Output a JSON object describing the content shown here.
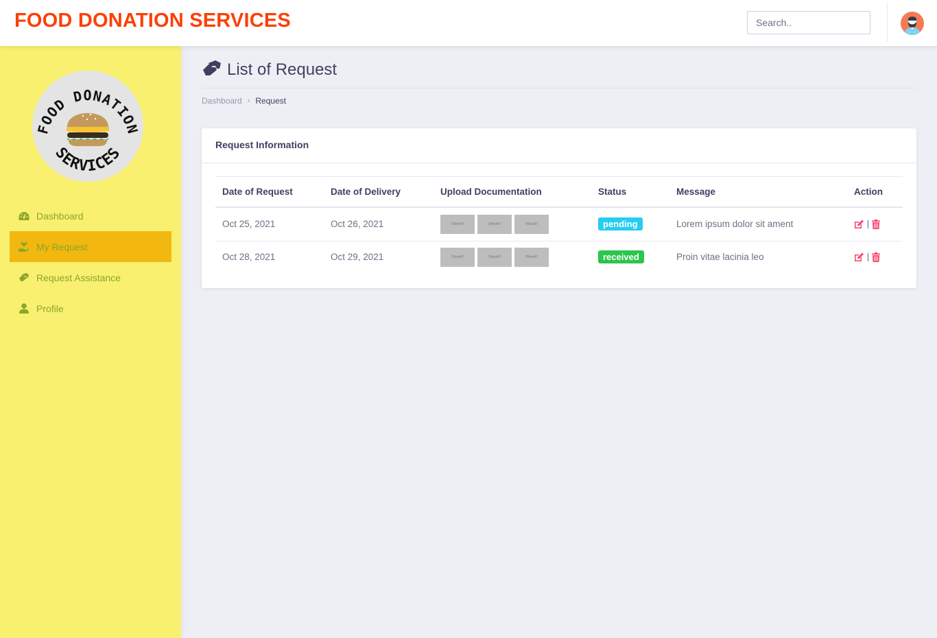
{
  "header": {
    "brand": "FOOD DONATION SERVICES",
    "search_placeholder": "Search..",
    "avatar_icon": "user-avatar-icon"
  },
  "sidebar": {
    "logo": {
      "top_text": "FOOD DONATION",
      "bottom_text": "SERVICES",
      "icon": "burger-icon"
    },
    "items": [
      {
        "label": "Dashboard",
        "icon": "speedometer-icon",
        "active": false
      },
      {
        "label": "My Request",
        "icon": "hand-heart-icon",
        "active": true
      },
      {
        "label": "Request Assistance",
        "icon": "handshake-icon",
        "active": false
      },
      {
        "label": "Profile",
        "icon": "user-icon",
        "active": false
      }
    ]
  },
  "page": {
    "title": "List of Request",
    "title_icon": "handshake-icon",
    "breadcrumb": [
      {
        "label": "Dashboard",
        "link": true
      },
      {
        "label": "Request",
        "link": false
      }
    ]
  },
  "card": {
    "title": "Request Information",
    "columns": [
      "Date of Request",
      "Date of Delivery",
      "Upload Documentation",
      "Status",
      "Message",
      "Action"
    ],
    "rows": [
      {
        "date_request": "Oct 25, 2021",
        "date_delivery": "Oct 26, 2021",
        "docs": [
          "784x447",
          "784x447",
          "784x447"
        ],
        "status": "pending",
        "status_color": "#25cdef",
        "message": "Lorem ipsum dolor sit ament"
      },
      {
        "date_request": "Oct 28, 2021",
        "date_delivery": "Oct 29, 2021",
        "docs": [
          "784x447",
          "784x447",
          "784x447"
        ],
        "status": "received",
        "status_color": "#2cc54d",
        "message": "Proin vitae lacinia leo"
      }
    ],
    "actions": {
      "edit_icon": "edit-icon",
      "delete_icon": "trash-icon",
      "color": "#f3426b"
    }
  },
  "colors": {
    "brand": "#fc4006",
    "sidebar_bg": "#f9f06f",
    "sidebar_active": "#f2b80f",
    "sidebar_text": "#8aa72a",
    "content_bg": "#eeeff5"
  }
}
